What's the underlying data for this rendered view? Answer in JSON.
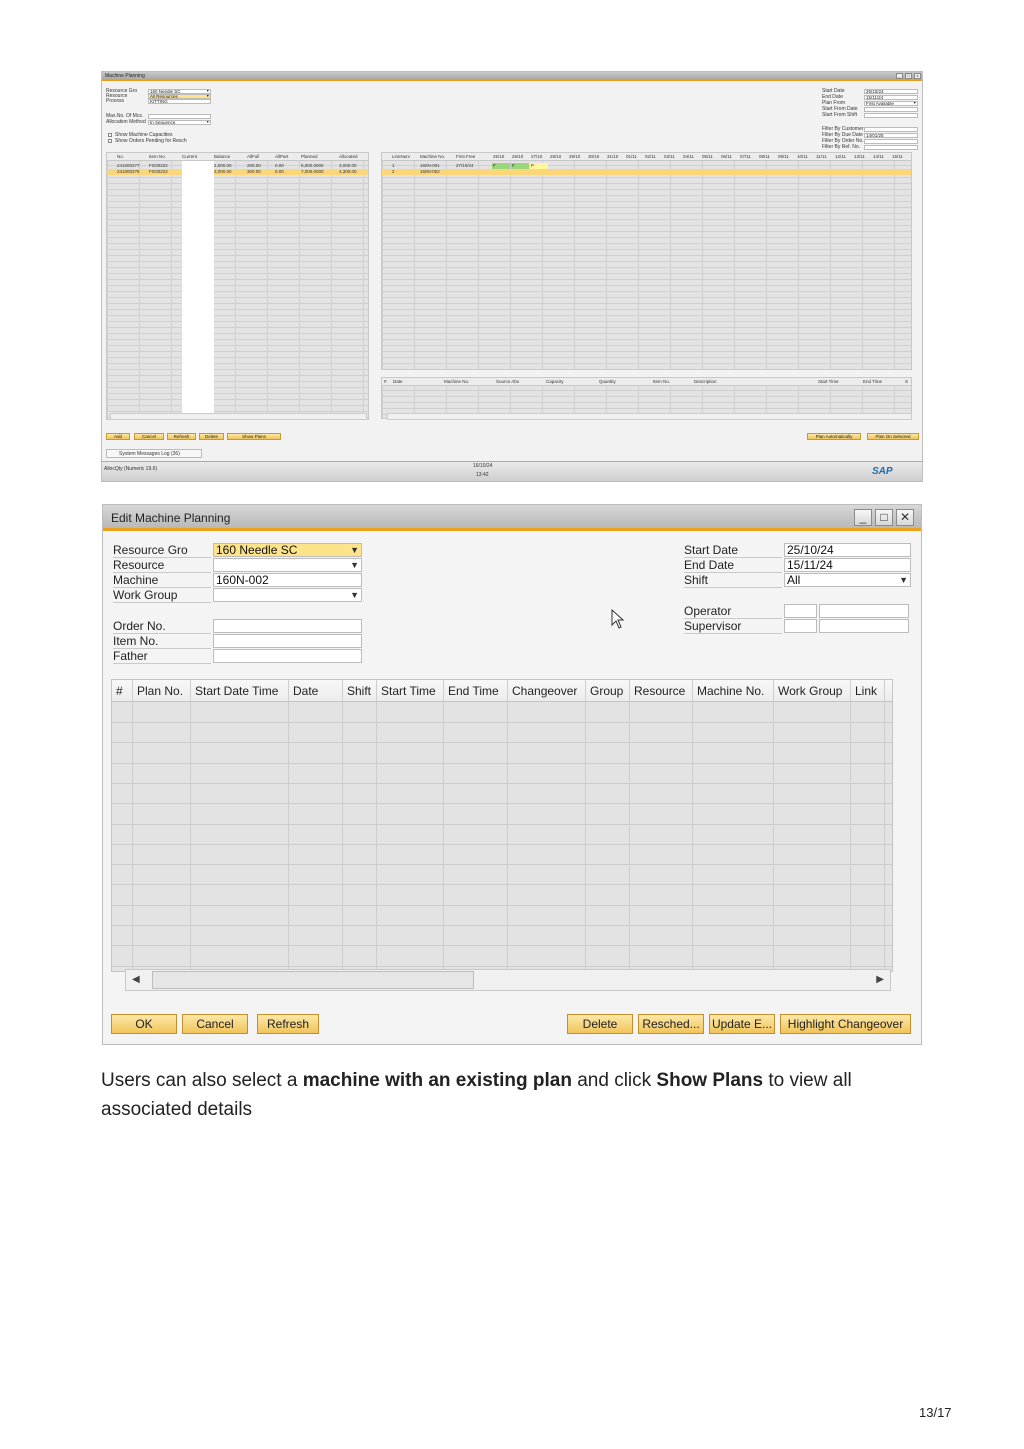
{
  "screenshot1": {
    "title": "Machine Planning",
    "left_fields": [
      {
        "label": "Resource Gro",
        "value": "160 Needle SC"
      },
      {
        "label": "Resource",
        "value": "All Resources"
      },
      {
        "label": "Process",
        "value": "KITTING"
      },
      {
        "label": "Max.No. Of Mcs.",
        "value": ""
      },
      {
        "label": "Allocation Method",
        "value": "In Sequence"
      }
    ],
    "checkboxes": [
      "Show Machine Capacities",
      "Show Orders Pending for Resch"
    ],
    "right_fields": [
      {
        "label": "Start Date",
        "value": "25/10/24"
      },
      {
        "label": "End Date",
        "value": "15/11/24"
      },
      {
        "label": "Plan From",
        "value": "First Available"
      },
      {
        "label": "Start From Date",
        "value": ""
      },
      {
        "label": "Start From Shift",
        "value": ""
      },
      {
        "label": "Filter By Customer",
        "value": ""
      },
      {
        "label": "Filter By Due Date",
        "value": "14/01/25"
      },
      {
        "label": "Filter By Order No.",
        "value": ""
      },
      {
        "label": "Filter By Ref. No.",
        "value": ""
      }
    ],
    "orders_columns": [
      "No.",
      "Item No.",
      "Current",
      "Balance",
      "AllFull",
      "AllPart",
      "Planned",
      "Allocated"
    ],
    "orders_rows": [
      [
        "241000277",
        "FG00222",
        "2,000.00",
        "2,000.00",
        "200.00",
        "0.00",
        "5,000.0000",
        "3,000.00"
      ],
      [
        "241000278",
        "FG00222",
        "3,000.00",
        "3,000.00",
        "300.00",
        "0.00",
        "7,000.0000",
        "4,300.00"
      ]
    ],
    "machines_columns": [
      "LineNum",
      "Machine No.",
      "First Free"
    ],
    "machines_dates": [
      "25/10",
      "26/10",
      "27/10",
      "28/10",
      "29/10",
      "30/10",
      "31/10",
      "01/11",
      "02/11",
      "03/11",
      "04/11",
      "05/11",
      "06/11",
      "07/11",
      "08/11",
      "09/11",
      "10/11",
      "11/11",
      "12/11",
      "13/11",
      "14/11",
      "15/11"
    ],
    "machines_rows": [
      [
        "1",
        "160N-001",
        "27/10/24",
        "F",
        "F",
        "P"
      ],
      [
        "2",
        "160N-002",
        "",
        "",
        "",
        ""
      ]
    ],
    "detail_columns": [
      "#",
      "Date",
      "Machine No.",
      "Source Abs",
      "Capacity",
      "Quantity",
      "Item No.",
      "Description",
      "Start Time",
      "End Time",
      "S"
    ],
    "buttons_left": [
      "Add",
      "Cancel",
      "Refresh",
      "Delete",
      "Show Plans"
    ],
    "buttons_right": [
      "Plan Automatically",
      "Plan On Selected"
    ],
    "messages_tab": "System Messages Log (36)",
    "status_text": "AllocQty (Numeric 19.6)",
    "status_date": "16/10/24",
    "status_time": "13:42",
    "logo": "SAP"
  },
  "screenshot2": {
    "title": "Edit Machine Planning",
    "window_buttons": [
      "_",
      "□",
      "✕"
    ],
    "left_fields": [
      {
        "label": "Resource Gro",
        "value": "160 Needle SC",
        "dropdown": true,
        "highlight": true
      },
      {
        "label": "Resource",
        "value": "",
        "dropdown": true
      },
      {
        "label": "Machine",
        "value": "160N-002"
      },
      {
        "label": "Work Group",
        "value": "",
        "dropdown": true
      },
      {
        "label": "Order No.",
        "value": ""
      },
      {
        "label": "Item No.",
        "value": ""
      },
      {
        "label": "Father",
        "value": ""
      }
    ],
    "right_fields": [
      {
        "label": "Start Date",
        "value": "25/10/24"
      },
      {
        "label": "End Date",
        "value": "15/11/24"
      },
      {
        "label": "Shift",
        "value": "All",
        "dropdown": true
      }
    ],
    "people_fields": [
      {
        "label": "Operator",
        "code": "",
        "name": ""
      },
      {
        "label": "Supervisor",
        "code": "",
        "name": ""
      }
    ],
    "grid_columns": [
      "#",
      "Plan No.",
      "Start Date Time",
      "Date",
      "Shift",
      "Start Time",
      "End Time",
      "Changeover",
      "Group",
      "Resource",
      "Machine No.",
      "Work Group",
      "Link"
    ],
    "buttons_left": [
      "OK",
      "Cancel",
      "Refresh"
    ],
    "buttons_right": [
      "Delete",
      "Resched...",
      "Update E...",
      "Highlight Changeover"
    ]
  },
  "caption": {
    "p1": "Users can also select a ",
    "b1": "machine with an existing plan",
    "p2": " and click ",
    "b2": "Show Plans",
    "p3": " to view all associated details"
  },
  "page_number": "13/17"
}
